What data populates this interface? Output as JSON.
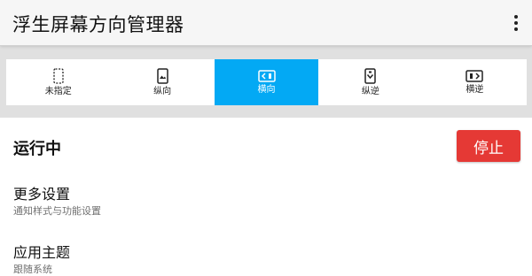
{
  "app": {
    "title": "浮生屏幕方向管理器"
  },
  "tabs": [
    {
      "label": "未指定",
      "icon": "unspecified-orientation-icon",
      "selected": false
    },
    {
      "label": "纵向",
      "icon": "portrait-icon",
      "selected": false
    },
    {
      "label": "横向",
      "icon": "landscape-icon",
      "selected": true
    },
    {
      "label": "纵逆",
      "icon": "reverse-portrait-icon",
      "selected": false
    },
    {
      "label": "横逆",
      "icon": "reverse-landscape-icon",
      "selected": false
    }
  ],
  "service": {
    "status": "运行中",
    "stop_label": "停止"
  },
  "settings": [
    {
      "title": "更多设置",
      "subtitle": "通知样式与功能设置"
    },
    {
      "title": "应用主题",
      "subtitle": "跟随系统"
    }
  ],
  "colors": {
    "accent": "#03a9f4",
    "stop": "#e53935",
    "background": "#e0e0e0"
  }
}
